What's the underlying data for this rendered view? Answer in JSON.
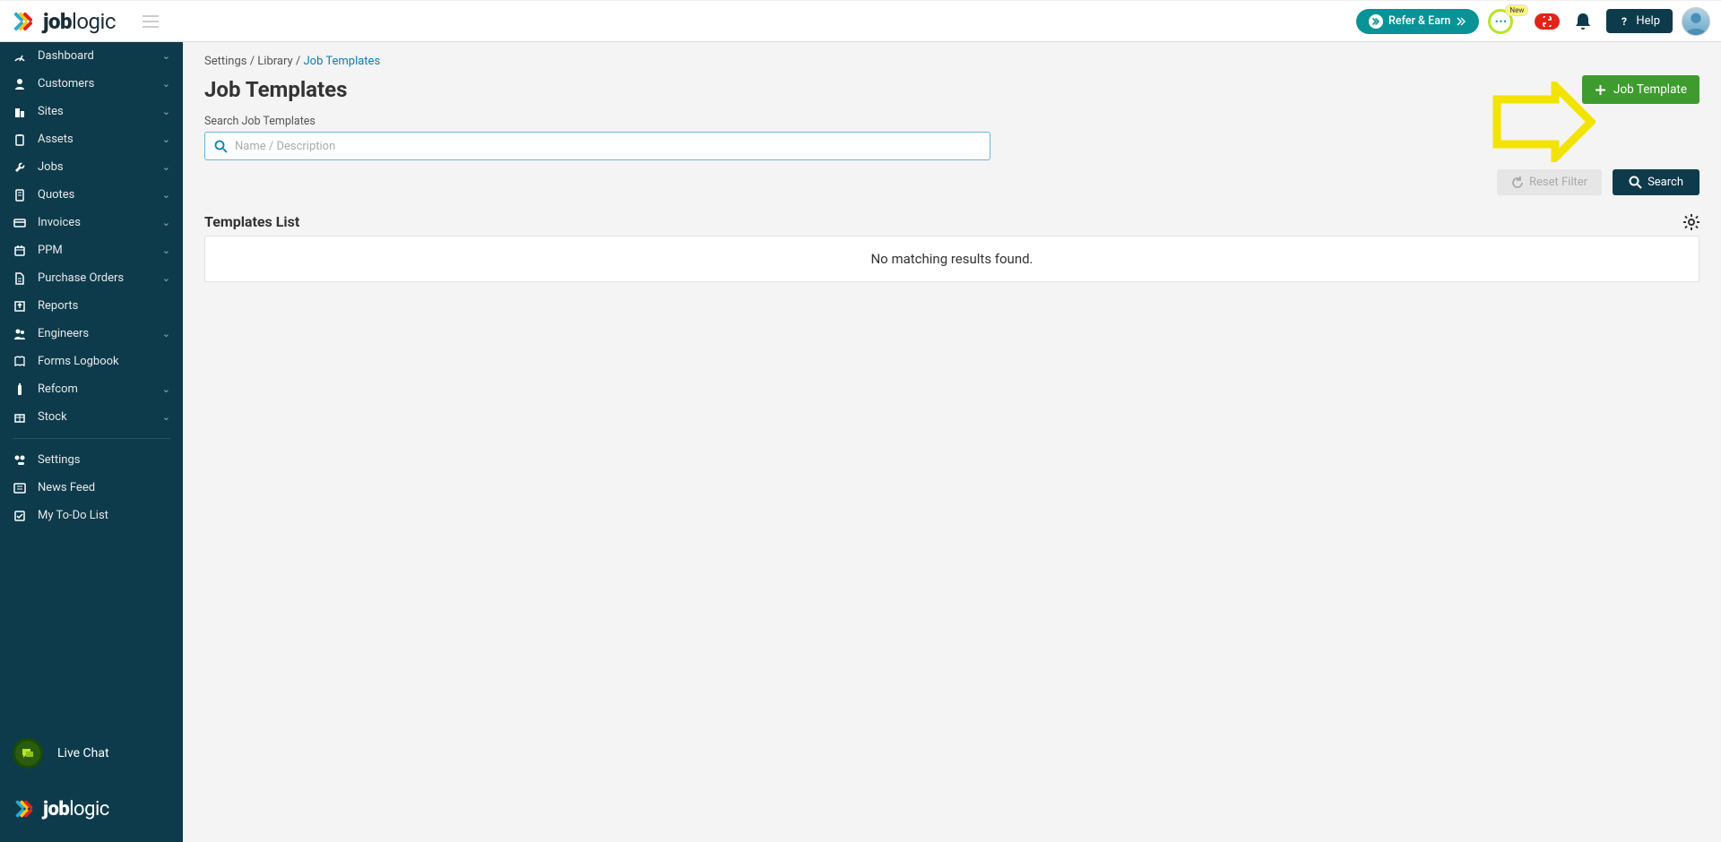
{
  "header": {
    "brand": "joblogic",
    "refer_label": "Refer & Earn",
    "new_badge": "New",
    "help_label": "Help"
  },
  "sidebar": {
    "items": [
      {
        "label": "Dashboard",
        "icon": "gauge",
        "expandable": true
      },
      {
        "label": "Customers",
        "icon": "user",
        "expandable": true
      },
      {
        "label": "Sites",
        "icon": "building",
        "expandable": true
      },
      {
        "label": "Assets",
        "icon": "clipboard",
        "expandable": true
      },
      {
        "label": "Jobs",
        "icon": "wrench",
        "expandable": true
      },
      {
        "label": "Quotes",
        "icon": "doc",
        "expandable": true
      },
      {
        "label": "Invoices",
        "icon": "card",
        "expandable": true
      },
      {
        "label": "PPM",
        "icon": "calendar",
        "expandable": true
      },
      {
        "label": "Purchase Orders",
        "icon": "file",
        "expandable": true
      },
      {
        "label": "Reports",
        "icon": "export",
        "expandable": false
      },
      {
        "label": "Engineers",
        "icon": "users",
        "expandable": true
      },
      {
        "label": "Forms Logbook",
        "icon": "book",
        "expandable": false
      },
      {
        "label": "Refcom",
        "icon": "cyl",
        "expandable": true
      },
      {
        "label": "Stock",
        "icon": "box",
        "expandable": true
      }
    ],
    "settings_label": "Settings",
    "news_label": "News Feed",
    "todo_label": "My To-Do List",
    "chat_label": "Live Chat",
    "footer_brand": "joblogic"
  },
  "breadcrumb": {
    "part1": "Settings",
    "part2": "Library",
    "active": "Job Templates"
  },
  "page": {
    "title": "Job Templates",
    "add_btn": "Job Template",
    "search_label": "Search Job Templates",
    "search_placeholder": "Name / Description",
    "reset_label": "Reset Filter",
    "search_btn": "Search",
    "list_title": "Templates List",
    "empty_msg": "No matching results found."
  }
}
